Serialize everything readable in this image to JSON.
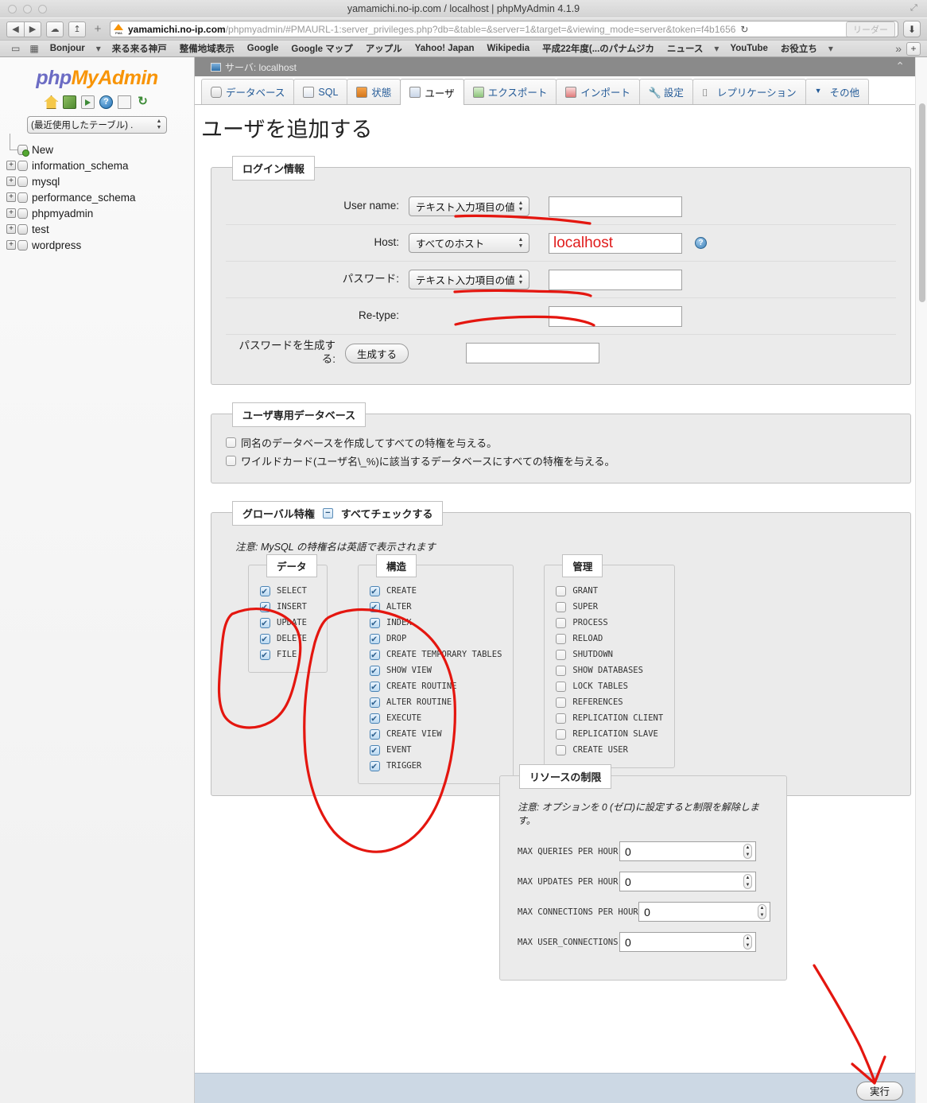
{
  "browser": {
    "window_title": "yamamichi.no-ip.com / localhost | phpMyAdmin 4.1.9",
    "url_host": "yamamichi.no-ip.com",
    "url_rest": "/phpmyadmin/#PMAURL-1:server_privileges.php?db=&table=&server=1&target=&viewing_mode=server&token=f4b1656",
    "favicon_label": "PMA",
    "reader_label": "リーダー",
    "reload_glyph": "↻",
    "back_glyph": "◀",
    "forward_glyph": "▶",
    "share_glyph": "↥",
    "cloud_glyph": "☁",
    "plus_glyph": "+",
    "download_glyph": "⬇",
    "fullscreen_glyph": "⤢",
    "bookmarks": [
      {
        "label": "Bonjour",
        "caret": true
      },
      {
        "label": "来る来る神戸",
        "caret": false
      },
      {
        "label": "整備地域表示",
        "caret": false
      },
      {
        "label": "Google",
        "caret": false
      },
      {
        "label": "Google マップ",
        "caret": false
      },
      {
        "label": "アップル",
        "caret": false
      },
      {
        "label": "Yahoo! Japan",
        "caret": false
      },
      {
        "label": "Wikipedia",
        "caret": false
      },
      {
        "label": "平成22年度(...のパナムジカ",
        "caret": false
      },
      {
        "label": "ニュース",
        "caret": true
      },
      {
        "label": "YouTube",
        "caret": false
      },
      {
        "label": "お役立ち",
        "caret": true
      }
    ],
    "bookmarks_overflow": "»",
    "bookmarks_add": "+"
  },
  "sidebar": {
    "logo_php": "php",
    "logo_myadmin": "MyAdmin",
    "icons": [
      {
        "name": "home-icon"
      },
      {
        "name": "exit-icon"
      },
      {
        "name": "query-window-icon"
      },
      {
        "name": "help-icon",
        "glyph": "?"
      },
      {
        "name": "documentation-icon"
      },
      {
        "name": "reload-icon",
        "glyph": "↻"
      }
    ],
    "recent_select": "(最近使用したテーブル) .",
    "tree": [
      {
        "label": "New",
        "expandable": false,
        "new": true
      },
      {
        "label": "information_schema",
        "expandable": true,
        "new": false
      },
      {
        "label": "mysql",
        "expandable": true,
        "new": false
      },
      {
        "label": "performance_schema",
        "expandable": true,
        "new": false
      },
      {
        "label": "phpmyadmin",
        "expandable": true,
        "new": false
      },
      {
        "label": "test",
        "expandable": true,
        "new": false
      },
      {
        "label": "wordpress",
        "expandable": true,
        "new": false
      }
    ],
    "expand_glyph": "+"
  },
  "content": {
    "server_bar": "サーバ: localhost",
    "collapse_glyph": "⌃",
    "tabs": [
      {
        "label": "データベース",
        "icon": "database-icon",
        "active": false
      },
      {
        "label": "SQL",
        "icon": "sql-icon",
        "active": false
      },
      {
        "label": "状態",
        "icon": "status-icon",
        "active": false
      },
      {
        "label": "ユーザ",
        "icon": "user-icon",
        "active": true
      },
      {
        "label": "エクスポート",
        "icon": "export-icon",
        "active": false
      },
      {
        "label": "インポート",
        "icon": "import-icon",
        "active": false
      },
      {
        "label": "設定",
        "icon": "wrench-icon",
        "active": false
      },
      {
        "label": "レプリケーション",
        "icon": "replication-icon",
        "active": false
      },
      {
        "label": "その他",
        "icon": "chevron-down-icon",
        "active": false
      }
    ],
    "page_title": "ユーザを追加する",
    "login_section": {
      "legend": "ログイン情報",
      "rows": [
        {
          "label": "User name:",
          "select": "テキスト入力項目の値",
          "has_select": true,
          "value": "",
          "annotated": false,
          "help": false
        },
        {
          "label": "Host:",
          "select": "すべてのホスト",
          "has_select": true,
          "value": "localhost",
          "annotated": true,
          "help": true
        },
        {
          "label": "パスワード:",
          "select": "テキスト入力項目の値",
          "has_select": true,
          "value": "",
          "annotated": false,
          "help": false
        },
        {
          "label": "Re-type:",
          "select": "",
          "has_select": false,
          "value": "",
          "annotated": false,
          "help": false
        }
      ],
      "generate_label": "パスワードを生成する:",
      "generate_button": "生成する",
      "generate_value": ""
    },
    "userdb_section": {
      "legend": "ユーザ専用データベース",
      "checkboxes": [
        {
          "label": "同名のデータベースを作成してすべての特権を与える。",
          "checked": false
        },
        {
          "label": "ワイルドカード(ユーザ名\\_%)に該当するデータベースにすべての特権を与える。",
          "checked": false
        }
      ]
    },
    "global_priv": {
      "legend": "グローバル特権",
      "check_all": "すべてチェックする",
      "check_all_glyph": "−",
      "note": "注意: MySQL の特権名は英語で表示されます",
      "columns": [
        {
          "legend": "データ",
          "items": [
            {
              "label": "SELECT",
              "checked": true
            },
            {
              "label": "INSERT",
              "checked": true
            },
            {
              "label": "UPDATE",
              "checked": true
            },
            {
              "label": "DELETE",
              "checked": true
            },
            {
              "label": "FILE",
              "checked": true
            }
          ]
        },
        {
          "legend": "構造",
          "items": [
            {
              "label": "CREATE",
              "checked": true
            },
            {
              "label": "ALTER",
              "checked": true
            },
            {
              "label": "INDEX",
              "checked": true
            },
            {
              "label": "DROP",
              "checked": true
            },
            {
              "label": "CREATE TEMPORARY TABLES",
              "checked": true
            },
            {
              "label": "SHOW VIEW",
              "checked": true
            },
            {
              "label": "CREATE ROUTINE",
              "checked": true
            },
            {
              "label": "ALTER ROUTINE",
              "checked": true
            },
            {
              "label": "EXECUTE",
              "checked": true
            },
            {
              "label": "CREATE VIEW",
              "checked": true
            },
            {
              "label": "EVENT",
              "checked": true
            },
            {
              "label": "TRIGGER",
              "checked": true
            }
          ]
        },
        {
          "legend": "管理",
          "items": [
            {
              "label": "GRANT",
              "checked": false
            },
            {
              "label": "SUPER",
              "checked": false
            },
            {
              "label": "PROCESS",
              "checked": false
            },
            {
              "label": "RELOAD",
              "checked": false
            },
            {
              "label": "SHUTDOWN",
              "checked": false
            },
            {
              "label": "SHOW DATABASES",
              "checked": false
            },
            {
              "label": "LOCK TABLES",
              "checked": false
            },
            {
              "label": "REFERENCES",
              "checked": false
            },
            {
              "label": "REPLICATION CLIENT",
              "checked": false
            },
            {
              "label": "REPLICATION SLAVE",
              "checked": false
            },
            {
              "label": "CREATE USER",
              "checked": false
            }
          ]
        }
      ]
    },
    "resource_limits": {
      "legend": "リソースの制限",
      "note": "注意: オプションを 0 (ゼロ)に設定すると制限を解除します。",
      "rows": [
        {
          "label": "MAX QUERIES PER HOUR",
          "value": "0",
          "wide": false
        },
        {
          "label": "MAX UPDATES PER HOUR",
          "value": "0",
          "wide": false
        },
        {
          "label": "MAX CONNECTIONS PER HOUR",
          "value": "0",
          "wide": true
        },
        {
          "label": "MAX USER_CONNECTIONS",
          "value": "0",
          "wide": false
        }
      ]
    },
    "footer": {
      "execute_label": "実行"
    }
  },
  "annotations": {
    "color": "#e4160f",
    "marks": [
      "underline-username-field",
      "handwritten-localhost",
      "underline-password-field",
      "underline-retype-field",
      "circle-data-privileges",
      "circle-structure-privileges",
      "arrow-to-execute-button"
    ]
  }
}
